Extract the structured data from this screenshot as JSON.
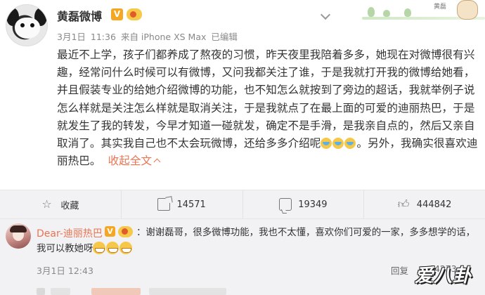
{
  "post": {
    "author": "黄磊微博",
    "verified_badge": "V",
    "meta": {
      "date": "3月1日",
      "time": "11:36",
      "source": "来自 iPhone XS Max",
      "edited": "已编辑"
    },
    "text": "最近不上学，孩子们都养成了熬夜的习惯，昨天夜里我陪着多多，她现在对微博很有兴趣，经常问什么时候可以有微博，又问我都关注了谁，于是我就打开我的微博给她看，并且假装专业的给她介绍微博的功能，也不知怎么就按到了旁边的超话，我就举例子说怎么样就是关注怎么样就是取消关注，于是我就点了在最上面的可爱的迪丽热巴，于是就发生了我的转发，今早才知道一碰就发，确定不是手滑，是我亲自点的，然后又亲自取消了。其实我自己也不太会玩微博，还给多多介绍呢",
    "text_tail": "。另外，我确实很喜欢迪丽热巴。",
    "collapse_label": "收起全文",
    "deco_tag": "黄磊"
  },
  "actions": [
    {
      "icon": "star-icon",
      "label": "收藏"
    },
    {
      "icon": "share-icon",
      "label": "14571"
    },
    {
      "icon": "comment-icon",
      "label": "19349"
    },
    {
      "icon": "like-icon",
      "label": "444842"
    }
  ],
  "comment": {
    "author": "Dear-迪丽热巴",
    "verified_badge": "V",
    "text": "：谢谢磊哥，很多微博功能，我也不太懂，喜欢你们可爱的一家，多多想学的话，我可以教她呀",
    "date": "3月1日",
    "time": "12:43",
    "reply_label": "回复",
    "likes": "94273"
  },
  "watermark": {
    "text": "爱八卦"
  }
}
